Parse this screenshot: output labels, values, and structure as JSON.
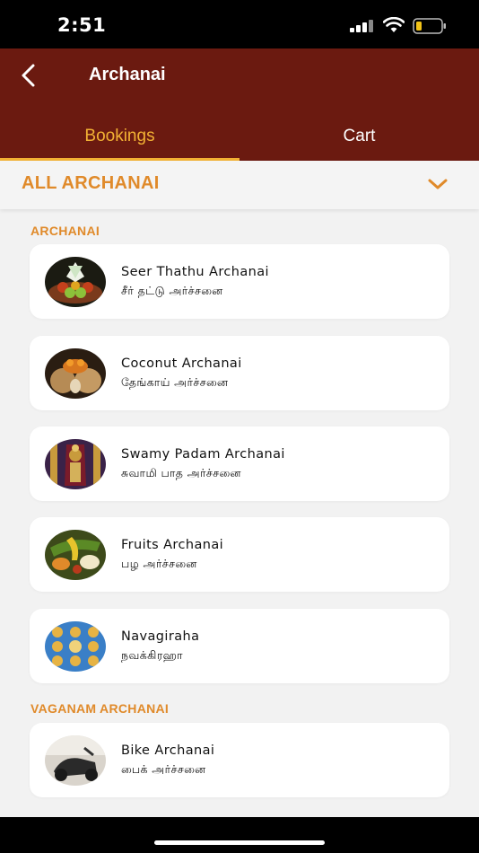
{
  "status": {
    "time": "2:51"
  },
  "header": {
    "title": "Archanai"
  },
  "tabs": [
    {
      "label": "Bookings",
      "active": true
    },
    {
      "label": "Cart",
      "active": false
    }
  ],
  "filter": {
    "selected": "ALL ARCHANAI"
  },
  "sections": [
    {
      "heading": "ARCHANAI",
      "items": [
        {
          "title": "Seer Thathu Archanai",
          "subtitle": "சீர் தட்டு அர்ச்சனை",
          "icon": "fruit-plate-image"
        },
        {
          "title": "Coconut Archanai",
          "subtitle": "தேங்காய் அர்ச்சனை",
          "icon": "coconut-image"
        },
        {
          "title": "Swamy Padam Archanai",
          "subtitle": "சுவாமி பாத அர்ச்சனை",
          "icon": "deity-image"
        },
        {
          "title": "Fruits Archanai",
          "subtitle": "பழ அர்ச்சனை",
          "icon": "fruits-image"
        },
        {
          "title": "Navagiraha",
          "subtitle": "நவக்கிரஹா",
          "icon": "navagraha-image"
        }
      ]
    },
    {
      "heading": "VAGANAM ARCHANAI",
      "items": [
        {
          "title": "Bike Archanai",
          "subtitle": "பைக் அர்ச்சனை",
          "icon": "bike-image"
        }
      ]
    }
  ],
  "colors": {
    "header_bg": "#6b1a10",
    "accent": "#e08a2a",
    "tab_active": "#f2b134"
  }
}
